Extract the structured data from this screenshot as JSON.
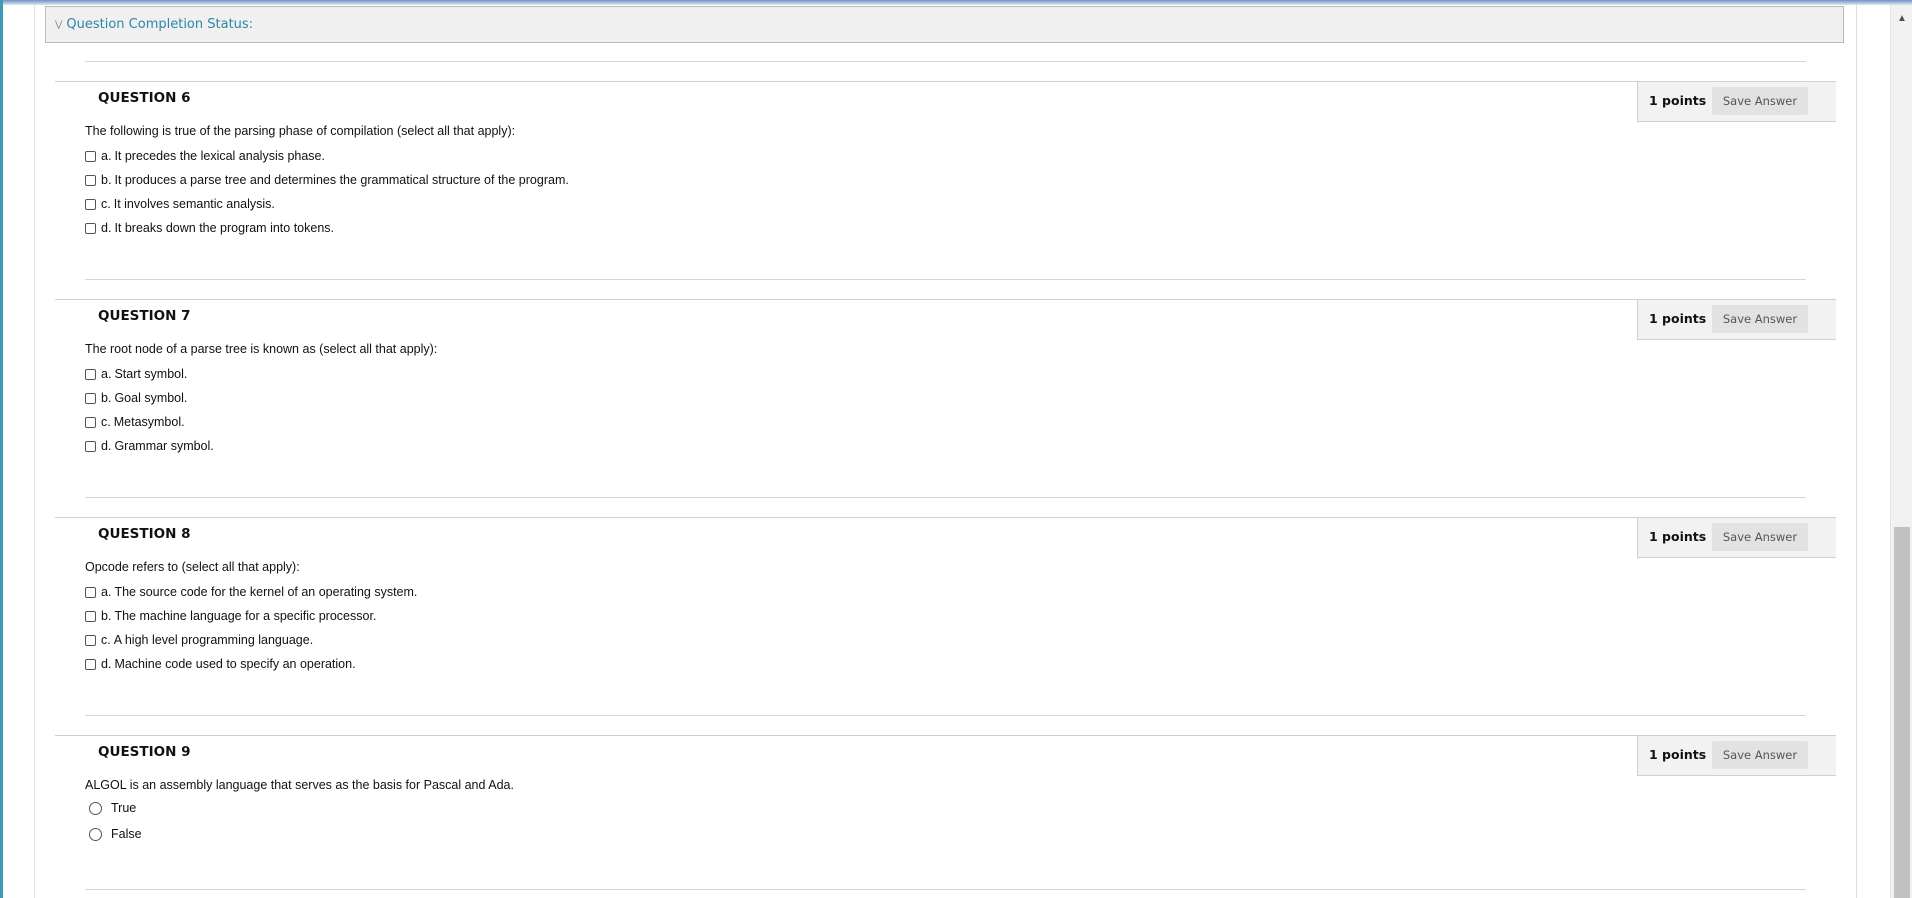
{
  "completion_status": {
    "label": "Question Completion Status:"
  },
  "questions": [
    {
      "title": "QUESTION 6",
      "points": "1 points",
      "save_label": "Save Answer",
      "prompt": "The following is true of the parsing phase of compilation (select all that apply):",
      "type": "checkbox",
      "options": [
        {
          "letter": "a.",
          "text": "It precedes the lexical analysis phase."
        },
        {
          "letter": "b.",
          "text": "It produces a parse tree and determines the grammatical structure of the program."
        },
        {
          "letter": "c.",
          "text": "It involves semantic analysis."
        },
        {
          "letter": "d.",
          "text": "It breaks down the program into tokens."
        }
      ]
    },
    {
      "title": "QUESTION 7",
      "points": "1 points",
      "save_label": "Save Answer",
      "prompt": "The root node of a parse tree is known as (select all that apply):",
      "type": "checkbox",
      "options": [
        {
          "letter": "a.",
          "text": "Start symbol."
        },
        {
          "letter": "b.",
          "text": "Goal symbol."
        },
        {
          "letter": "c.",
          "text": "Metasymbol."
        },
        {
          "letter": "d.",
          "text": "Grammar symbol."
        }
      ]
    },
    {
      "title": "QUESTION 8",
      "points": "1 points",
      "save_label": "Save Answer",
      "prompt": "Opcode refers to (select all that apply):",
      "type": "checkbox",
      "options": [
        {
          "letter": "a.",
          "text": "The source code for the kernel of an operating system."
        },
        {
          "letter": "b.",
          "text": "The machine language for a specific processor."
        },
        {
          "letter": "c.",
          "text": "A high level programming language."
        },
        {
          "letter": "d.",
          "text": "Machine code used to specify an operation."
        }
      ]
    },
    {
      "title": "QUESTION 9",
      "points": "1 points",
      "save_label": "Save Answer",
      "prompt": "ALGOL is an assembly language that serves as the basis for Pascal and Ada.",
      "type": "radio",
      "options": [
        {
          "letter": "",
          "text": "True"
        },
        {
          "letter": "",
          "text": "False"
        }
      ]
    }
  ]
}
